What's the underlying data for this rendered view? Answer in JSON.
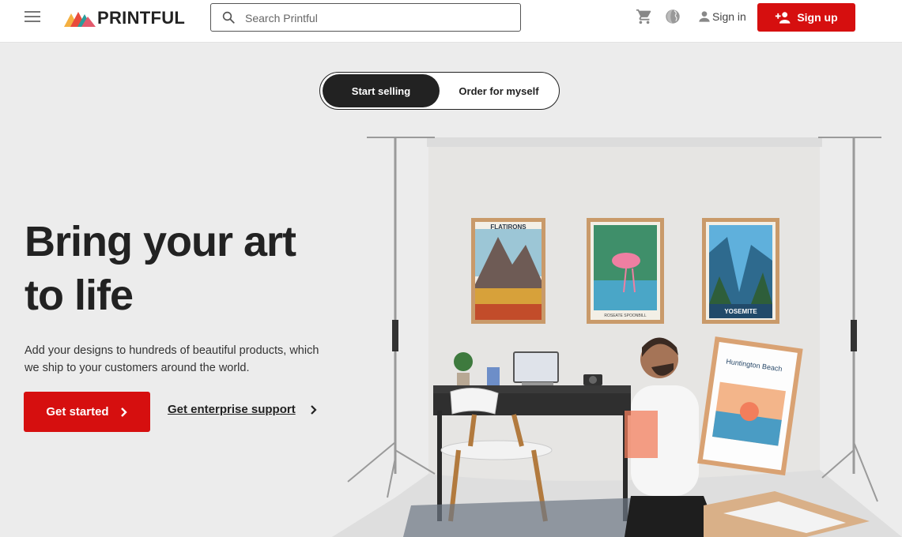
{
  "header": {
    "brand": "PRINTFUL",
    "search_placeholder": "Search Printful",
    "signin_label": "Sign in",
    "signup_label": "Sign up",
    "icons": [
      "menu-icon",
      "search-icon",
      "cart-icon",
      "globe-icon",
      "person-icon",
      "person-add-icon"
    ]
  },
  "toggle": {
    "active_label": "Start selling",
    "inactive_label": "Order for myself"
  },
  "hero": {
    "title_line1": "Bring your art",
    "title_line2": "to life",
    "description": "Add your designs to hundreds of beautiful products, which we ship to your customers around the world.",
    "cta_primary": "Get started",
    "cta_secondary": "Get enterprise support"
  },
  "scene": {
    "poster1_title": "FLATIRONS",
    "poster2_caption": "ROSEATE SPOONBILL",
    "poster3_title": "YOSEMITE",
    "held_poster_title": "Huntington Beach"
  },
  "colors": {
    "brand_red": "#d60f0f",
    "dark": "#222222",
    "background": "#ececec"
  }
}
